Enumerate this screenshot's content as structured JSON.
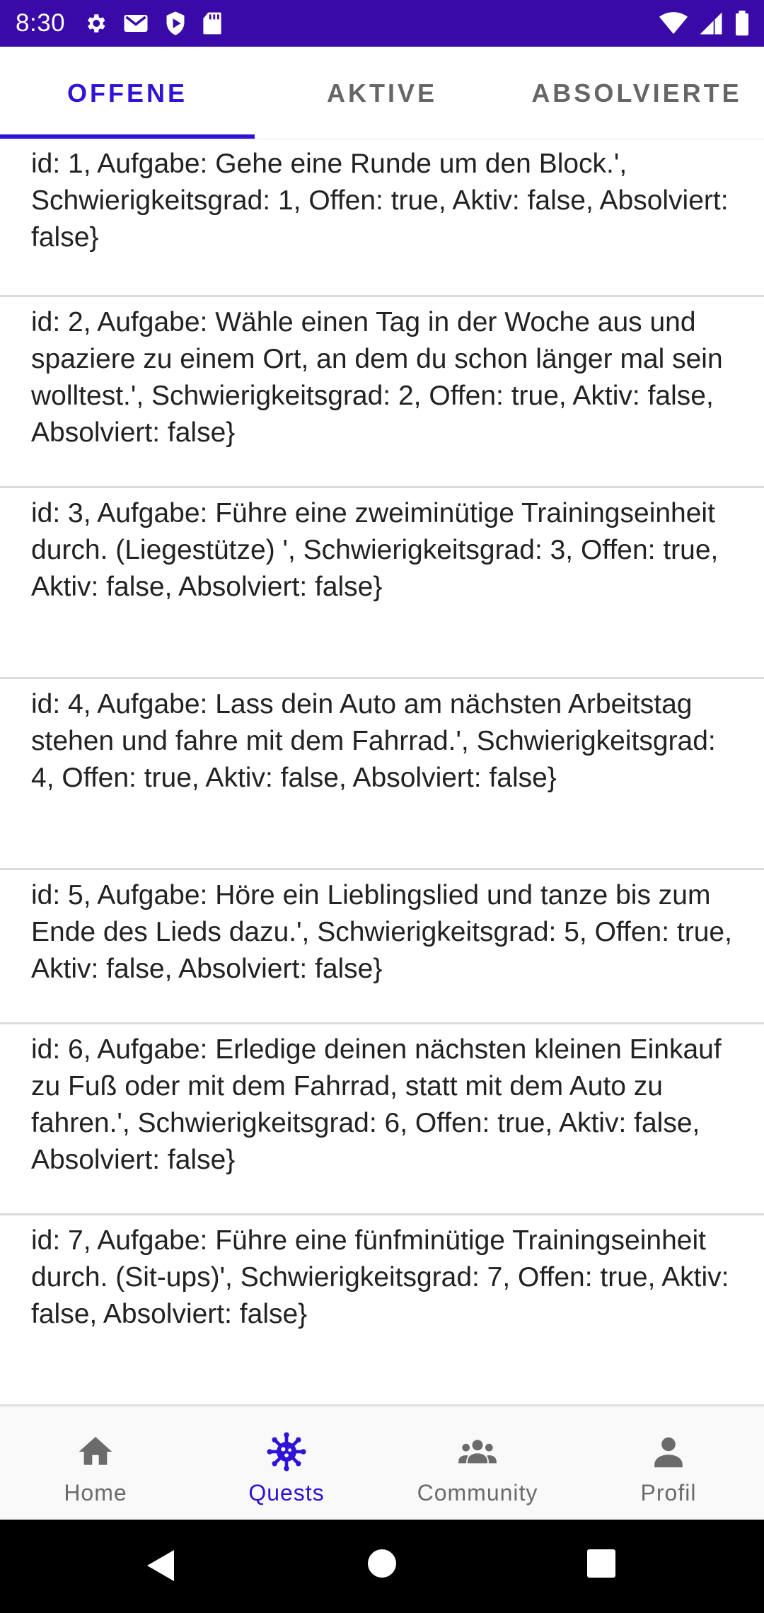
{
  "status_bar": {
    "time": "8:30",
    "left_icons": [
      "gear-icon",
      "mail-icon",
      "shield-play-icon",
      "sd-card-icon"
    ],
    "right_icons": [
      "wifi-icon",
      "signal-icon",
      "battery-icon"
    ],
    "background": "#3a0aa8"
  },
  "tabs": [
    {
      "label": "OFFENE",
      "active": true
    },
    {
      "label": "AKTIVE",
      "active": false
    },
    {
      "label": "ABSOLVIERTE",
      "active": false
    }
  ],
  "accent_color": "#2f13d6",
  "quests": [
    {
      "text": "id: 1, Aufgabe: Gehe eine Runde um den Block.', Schwierigkeitsgrad: 1, Offen: true, Aktiv: false, Absolviert: false}"
    },
    {
      "text": "id: 2, Aufgabe: Wähle einen Tag in der Woche aus und spaziere zu einem Ort, an dem du schon länger mal sein wolltest.', Schwierigkeitsgrad: 2, Offen: true, Aktiv: false, Absolviert: false}"
    },
    {
      "text": "id: 3, Aufgabe: Führe eine zweiminütige Trainingseinheit durch. (Liegestütze) ', Schwierigkeitsgrad: 3, Offen: true, Aktiv: false, Absolviert: false}"
    },
    {
      "text": "id: 4, Aufgabe: Lass dein Auto am nächsten Arbeitstag stehen und fahre mit dem Fahrrad.', Schwierigkeitsgrad: 4, Offen: true, Aktiv: false, Absolviert: false}"
    },
    {
      "text": "id: 5, Aufgabe: Höre ein Lieblingslied und tanze bis zum Ende des Lieds dazu.', Schwierigkeitsgrad: 5, Offen: true, Aktiv: false, Absolviert: false}"
    },
    {
      "text": "id: 6, Aufgabe: Erledige deinen nächsten kleinen Einkauf zu Fuß oder mit dem Fahrrad, statt mit dem Auto zu fahren.', Schwierigkeitsgrad: 6, Offen: true, Aktiv: false, Absolviert: false}"
    },
    {
      "text": "id: 7, Aufgabe: Führe eine fünfminütige Trainingseinheit durch. (Sit-ups)', Schwierigkeitsgrad: 7, Offen: true, Aktiv: false, Absolviert: false}"
    }
  ],
  "bottom_nav": [
    {
      "label": "Home",
      "icon": "home-icon",
      "active": false
    },
    {
      "label": "Quests",
      "icon": "virus-icon",
      "active": true
    },
    {
      "label": "Community",
      "icon": "group-icon",
      "active": false
    },
    {
      "label": "Profil",
      "icon": "person-icon",
      "active": false
    }
  ],
  "system_nav": [
    "back-icon",
    "home-circle-icon",
    "recents-icon"
  ]
}
